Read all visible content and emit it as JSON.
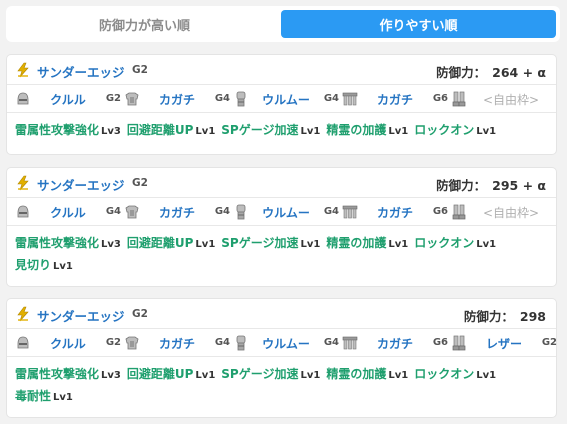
{
  "tabs": [
    {
      "label": "防御力が高い順"
    },
    {
      "label": "作りやすい順"
    }
  ],
  "colors": {
    "accent": "#2b9af3",
    "link": "#2574c2",
    "skill": "#1f9f6e",
    "weapon_icon": "#e2b000",
    "armor_icon": "#888888"
  },
  "cards": [
    {
      "weapon": {
        "name": "サンダーエッジ",
        "grade": "G2",
        "icon": "lightning-icon"
      },
      "defense_label": "防御力：",
      "defense_value": "264 + α",
      "armor": [
        {
          "icon": "helmet-icon",
          "name": "クルル",
          "grade": "G2"
        },
        {
          "icon": "chest-armor-icon",
          "name": "カガチ",
          "grade": "G4"
        },
        {
          "icon": "arm-armor-icon",
          "name": "ウルムー",
          "grade": "G4"
        },
        {
          "icon": "waist-armor-icon",
          "name": "カガチ",
          "grade": "G6"
        },
        {
          "icon": "leg-armor-icon",
          "name": "<自由枠>",
          "grade": ""
        }
      ],
      "skills": [
        {
          "name": "雷属性攻撃強化",
          "lv": "Lv3"
        },
        {
          "name": "回避距離UP",
          "lv": "Lv1"
        },
        {
          "name": "SPゲージ加速",
          "lv": "Lv1"
        },
        {
          "name": "精霊の加護",
          "lv": "Lv1"
        },
        {
          "name": "ロックオン",
          "lv": "Lv1"
        }
      ]
    },
    {
      "weapon": {
        "name": "サンダーエッジ",
        "grade": "G2",
        "icon": "lightning-icon"
      },
      "defense_label": "防御力：",
      "defense_value": "295 + α",
      "armor": [
        {
          "icon": "helmet-icon",
          "name": "クルル",
          "grade": "G4"
        },
        {
          "icon": "chest-armor-icon",
          "name": "カガチ",
          "grade": "G4"
        },
        {
          "icon": "arm-armor-icon",
          "name": "ウルムー",
          "grade": "G4"
        },
        {
          "icon": "waist-armor-icon",
          "name": "カガチ",
          "grade": "G6"
        },
        {
          "icon": "leg-armor-icon",
          "name": "<自由枠>",
          "grade": ""
        }
      ],
      "skills": [
        {
          "name": "雷属性攻撃強化",
          "lv": "Lv3"
        },
        {
          "name": "回避距離UP",
          "lv": "Lv1"
        },
        {
          "name": "SPゲージ加速",
          "lv": "Lv1"
        },
        {
          "name": "精霊の加護",
          "lv": "Lv1"
        },
        {
          "name": "ロックオン",
          "lv": "Lv1"
        },
        {
          "name": "見切り",
          "lv": "Lv1"
        }
      ]
    },
    {
      "weapon": {
        "name": "サンダーエッジ",
        "grade": "G2",
        "icon": "lightning-icon"
      },
      "defense_label": "防御力：",
      "defense_value": "298",
      "armor": [
        {
          "icon": "helmet-icon",
          "name": "クルル",
          "grade": "G2"
        },
        {
          "icon": "chest-armor-icon",
          "name": "カガチ",
          "grade": "G4"
        },
        {
          "icon": "arm-armor-icon",
          "name": "ウルムー",
          "grade": "G4"
        },
        {
          "icon": "waist-armor-icon",
          "name": "カガチ",
          "grade": "G6"
        },
        {
          "icon": "leg-armor-icon",
          "name": "レザー",
          "grade": "G2"
        }
      ],
      "skills": [
        {
          "name": "雷属性攻撃強化",
          "lv": "Lv3"
        },
        {
          "name": "回避距離UP",
          "lv": "Lv1"
        },
        {
          "name": "SPゲージ加速",
          "lv": "Lv1"
        },
        {
          "name": "精霊の加護",
          "lv": "Lv1"
        },
        {
          "name": "ロックオン",
          "lv": "Lv1"
        },
        {
          "name": "毒耐性",
          "lv": "Lv1"
        }
      ]
    }
  ]
}
